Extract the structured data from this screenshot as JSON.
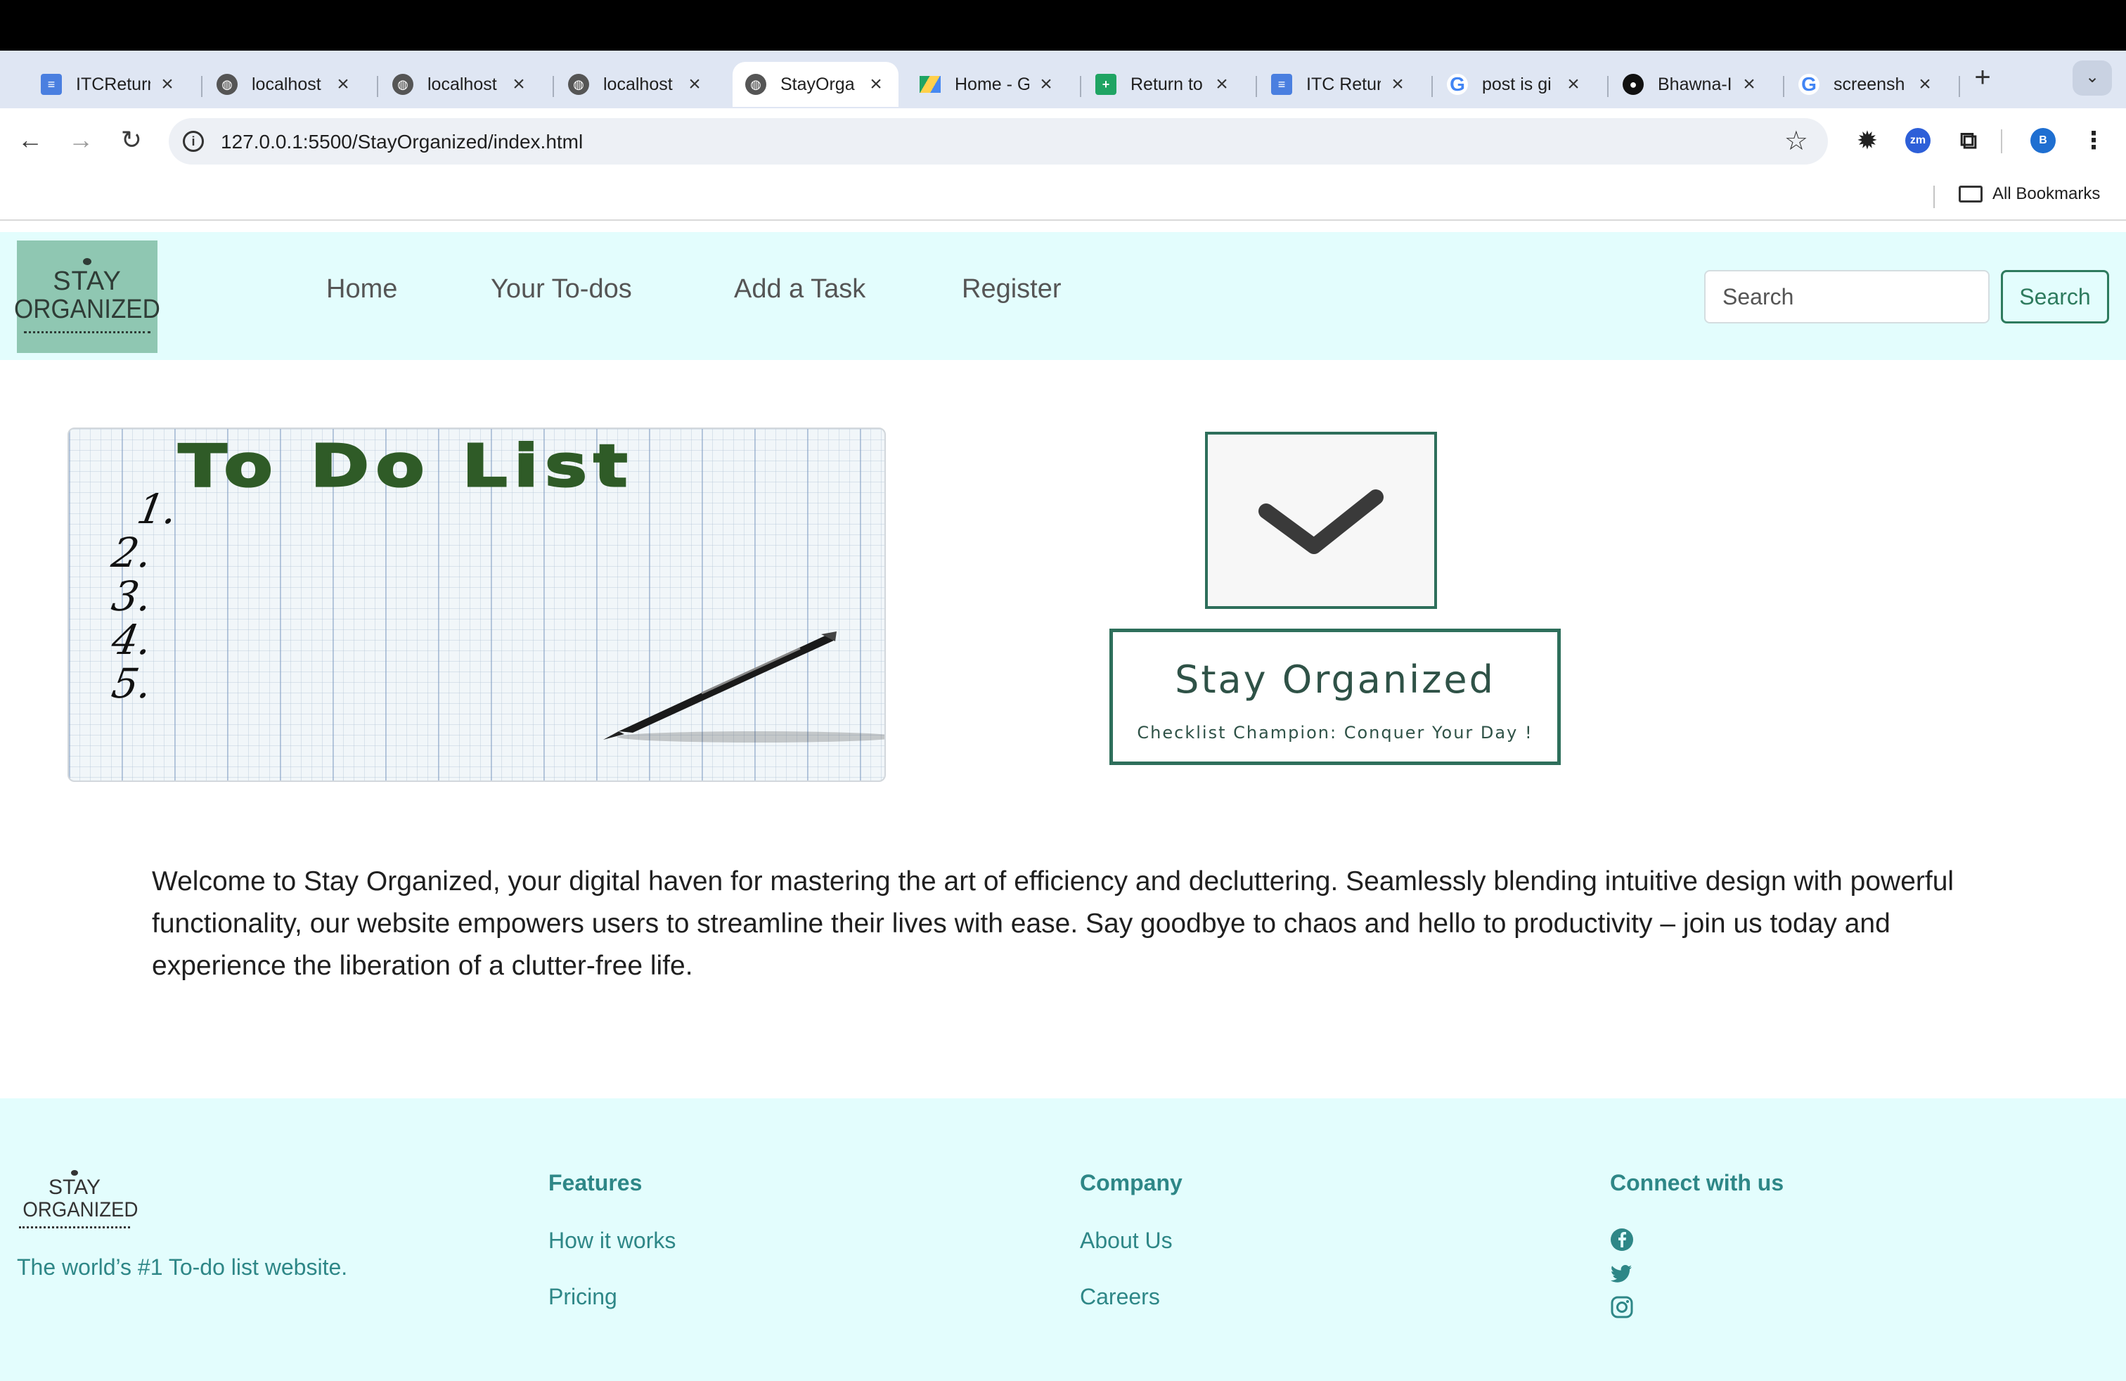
{
  "browser": {
    "tabs": [
      {
        "label": "ITCReturn",
        "icon": "docs-icon",
        "active": false
      },
      {
        "label": "localhost",
        "icon": "globe-icon",
        "active": false
      },
      {
        "label": "localhost",
        "icon": "globe-icon",
        "active": false
      },
      {
        "label": "localhost",
        "icon": "globe-icon",
        "active": false
      },
      {
        "label": "StayOrga",
        "icon": "globe-icon",
        "active": true
      },
      {
        "label": "Home - G",
        "icon": "drive-icon",
        "active": false
      },
      {
        "label": "Return to",
        "icon": "sheets-icon",
        "active": false
      },
      {
        "label": "ITC Retur",
        "icon": "docs-icon",
        "active": false
      },
      {
        "label": "post is gi",
        "icon": "google-icon",
        "active": false
      },
      {
        "label": "Bhawna-I",
        "icon": "github-icon",
        "active": false
      },
      {
        "label": "screensh",
        "icon": "google-icon",
        "active": false
      }
    ],
    "url": "127.0.0.1:5500/StayOrganized/index.html",
    "profile_initial": "B",
    "zoom_ext_label": "zm",
    "all_bookmarks": "All Bookmarks"
  },
  "site": {
    "logo": {
      "line1": "STAY",
      "line2": "ORGANIZED"
    },
    "nav": [
      "Home",
      "Your To-dos",
      "Add a Task",
      "Register"
    ],
    "search": {
      "placeholder": "Search",
      "button": "Search"
    },
    "hero_image": {
      "title": "To Do List",
      "numbers": [
        "1.",
        "2.",
        "3.",
        "4.",
        "5."
      ]
    },
    "brand": {
      "title": "Stay Organized",
      "subtitle": "Checklist Champion: Conquer Your Day !"
    },
    "intro": "Welcome to Stay Organized, your digital haven for mastering the art of efficiency and decluttering. Seamlessly blending intuitive design with powerful functionality, our website empowers users to streamline their lives with ease. Say goodbye to chaos and hello to productivity – join us today and experience the liberation of a clutter-free life."
  },
  "footer": {
    "logo": {
      "line1": "STAY",
      "line2": "ORGANIZED"
    },
    "tagline": "The world’s #1 To-do list website.",
    "features": {
      "heading": "Features",
      "links": [
        "How it works",
        "Pricing"
      ]
    },
    "company": {
      "heading": "Company",
      "links": [
        "About Us",
        "Careers"
      ]
    },
    "connect": {
      "heading": "Connect with us",
      "icons": [
        "facebook-icon",
        "twitter-icon",
        "instagram-icon"
      ]
    }
  },
  "colors": {
    "accent": "#2e7b5e",
    "nav_bg": "#e3fdfd",
    "footer_text": "#2e8787",
    "title_green": "#2f5b27"
  }
}
